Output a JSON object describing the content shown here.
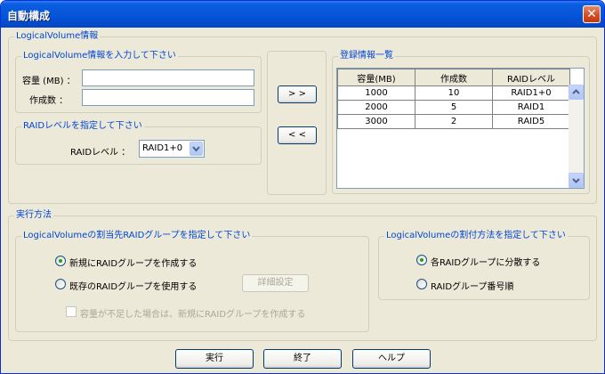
{
  "window": {
    "title": "自動構成",
    "close_glyph": "✕"
  },
  "lv_info": {
    "legend": "LogicalVolume情報",
    "input_group": {
      "legend": "LogicalVolume情報を入力して下さい",
      "capacity_label": "容量 (MB) ：",
      "capacity_value": "",
      "count_label": "作成数 ：",
      "count_value": ""
    },
    "raid_group": {
      "legend": "RAIDレベルを指定して下さい",
      "raid_label": "RAIDレベル ：",
      "raid_value": "RAID1+0"
    },
    "add_button": "> >",
    "remove_button": "< <"
  },
  "registered": {
    "legend": "登録情報一覧",
    "columns": [
      "容量(MB)",
      "作成数",
      "RAIDレベル"
    ],
    "rows": [
      [
        "1000",
        "10",
        "RAID1+0"
      ],
      [
        "2000",
        "5",
        "RAID1"
      ],
      [
        "3000",
        "2",
        "RAID5"
      ]
    ]
  },
  "execution": {
    "legend": "実行方法",
    "target_group": {
      "legend": "LogicalVolumeの割当先RAIDグループを指定して下さい",
      "option_new": "新規にRAIDグループを作成する",
      "option_existing": "既存のRAIDグループを使用する",
      "detail_button": "詳細設定",
      "fallback_check": "容量が不足した場合は、新規にRAIDグループを作成する"
    },
    "method_group": {
      "legend": "LogicalVolumeの割付方法を指定して下さい",
      "option_distribute": "各RAIDグループに分散する",
      "option_number": "RAIDグループ番号順"
    }
  },
  "footer": {
    "run": "実行",
    "exit": "終了",
    "help": "ヘルプ"
  },
  "state": {
    "target_selected": "new",
    "method_selected": "distribute",
    "fallback_checked": false,
    "fallback_enabled": false,
    "detail_enabled": false
  },
  "colors": {
    "legend_text": "#0046d5",
    "title_bar": "#0553d6",
    "radio_dot": "#21a121"
  }
}
